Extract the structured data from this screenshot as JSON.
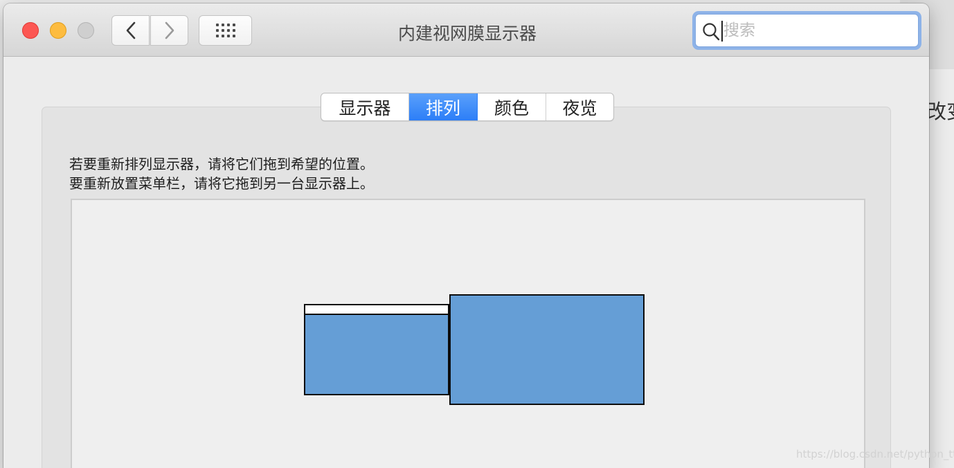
{
  "window": {
    "title": "内建视网膜显示器"
  },
  "toolbar": {
    "back_icon": "chevron-left-icon",
    "forward_icon": "chevron-right-icon",
    "show_all_icon": "grid-icon"
  },
  "search": {
    "placeholder": "搜索",
    "value": ""
  },
  "tabs": [
    {
      "label": "显示器",
      "active": false
    },
    {
      "label": "排列",
      "active": true
    },
    {
      "label": "颜色",
      "active": false
    },
    {
      "label": "夜览",
      "active": false
    }
  ],
  "instructions": {
    "line1": "若要重新排列显示器，请将它们拖到希望的位置。",
    "line2": "要重新放置菜单栏，请将它拖到另一台显示器上。"
  },
  "background_window": {
    "partial_text": "改变"
  },
  "watermark": "https://blog.csdn.net/python_tty",
  "colors": {
    "accent": "#2c7ef7",
    "display_fill": "#659ed6",
    "close": "#fc5753",
    "minimize": "#fdbc40",
    "zoom_disabled": "#cfcfcf"
  }
}
